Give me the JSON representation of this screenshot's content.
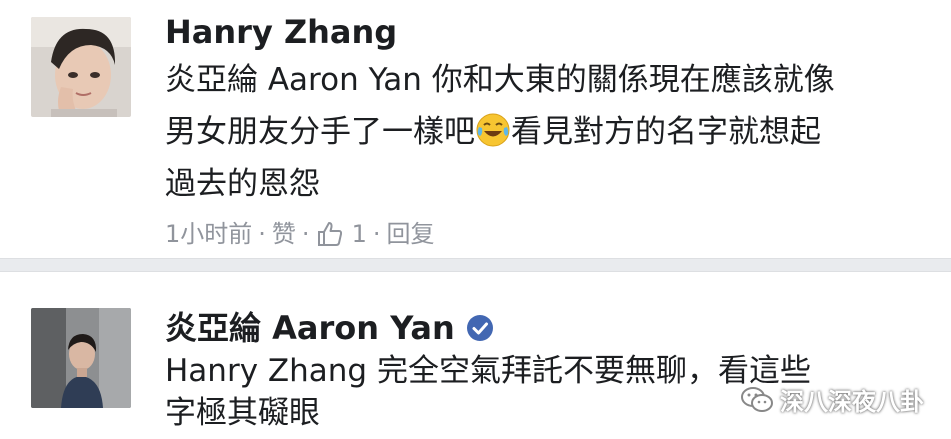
{
  "comments": [
    {
      "author": "Hanry Zhang",
      "lines": [
        "炎亞綸 Aaron Yan 你和大東的關係現在應該就像",
        "男女朋友分手了一樣吧",
        "看見對方的名字就想起",
        "過去的恩怨"
      ],
      "emoji": "tears-of-joy-emoji",
      "meta": {
        "time": "1小时前",
        "like": "赞",
        "like_count": "1",
        "reply": "回复",
        "separator": "·"
      }
    },
    {
      "author": "炎亞綸 Aaron Yan",
      "verified": true,
      "lines": [
        "Hanry Zhang 完全空氣拜託不要無聊，看這些",
        "字極其礙眼"
      ]
    }
  ],
  "watermark": {
    "text": "深八深夜八卦",
    "icon": "wechat-icon"
  },
  "colors": {
    "verified_blue": "#4267b2",
    "meta_gray": "#90949c",
    "divider": "#e9ebee"
  }
}
